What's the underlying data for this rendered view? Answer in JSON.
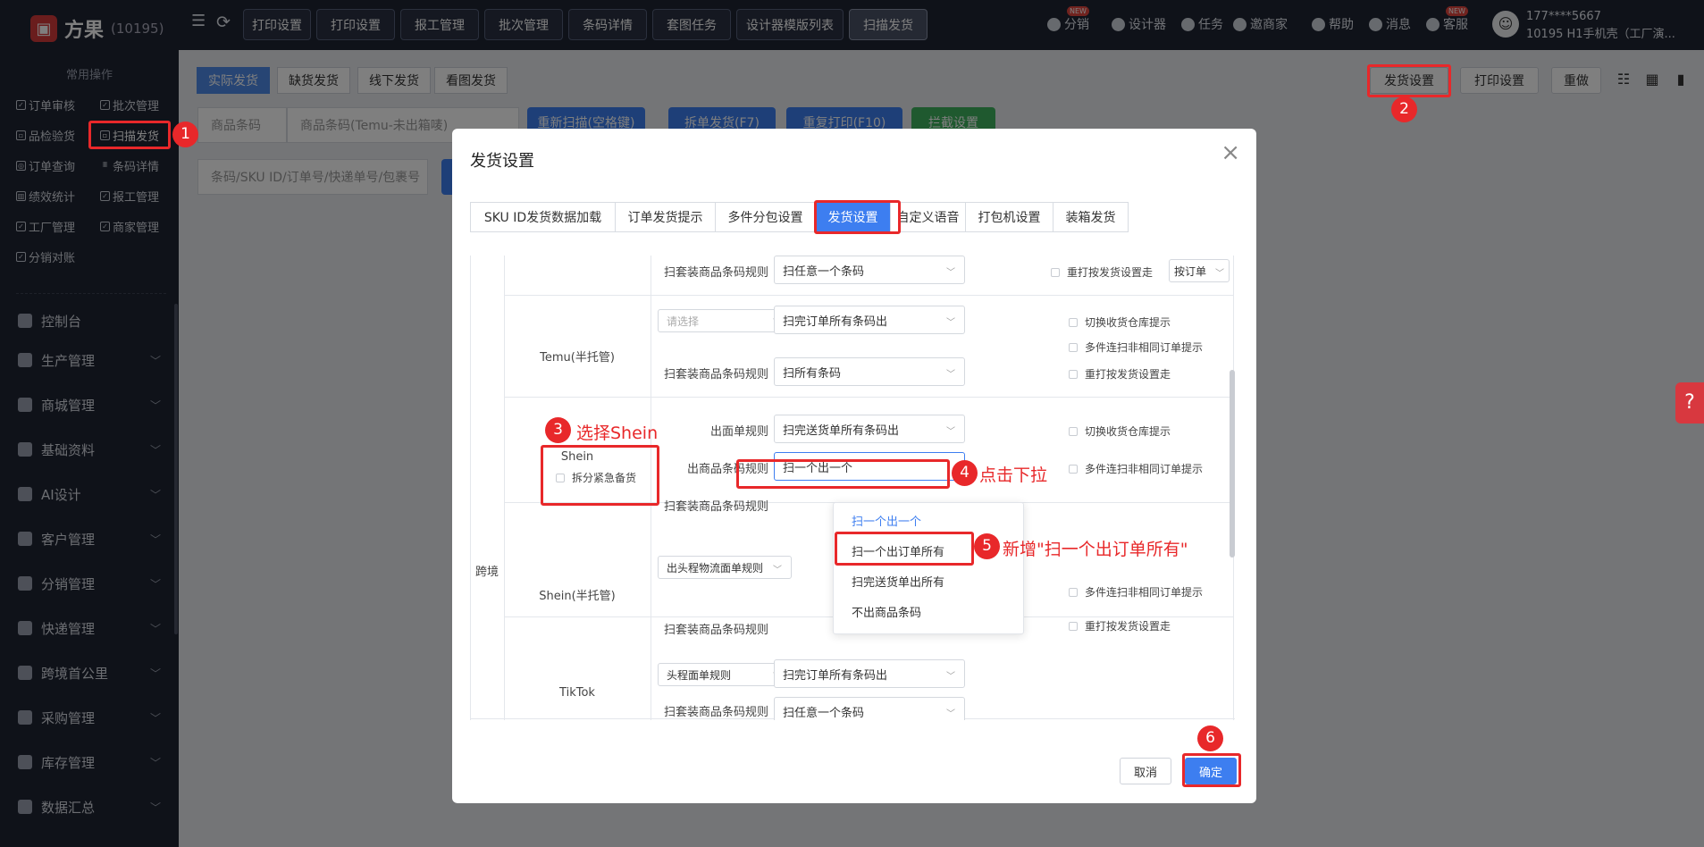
{
  "app": {
    "name": "方果",
    "count": "(10195)"
  },
  "sidebar": {
    "common_title": "常用操作",
    "quick": [
      "订单审核",
      "批次管理",
      "品检验货",
      "扫描发货",
      "订单查询",
      "条码详情",
      "绩效统计",
      "报工管理",
      "工厂管理",
      "商家管理",
      "分销对账"
    ],
    "nav": [
      "控制台",
      "生产管理",
      "商城管理",
      "基础资料",
      "AI设计",
      "客户管理",
      "分销管理",
      "快递管理",
      "跨境首公里",
      "采购管理",
      "库存管理",
      "数据汇总"
    ]
  },
  "topbar": {
    "tabs": [
      "打印设置",
      "打印设置",
      "报工管理",
      "批次管理",
      "条码详情",
      "套图任务",
      "设计器模版列表",
      "扫描发货"
    ],
    "right": [
      "分销",
      "设计器",
      "任务",
      "邀商家",
      "帮助",
      "消息",
      "客服"
    ],
    "new_badge": "NEW",
    "user_line1": "177****5667",
    "user_line2": "10195 H1手机壳（工厂演..."
  },
  "content": {
    "tabs": [
      "实际发货",
      "缺货发货",
      "线下发货",
      "看图发货"
    ],
    "right_buttons": [
      "发货设置",
      "打印设置",
      "重做"
    ],
    "product_select": "商品条码",
    "product_placeholder": "商品条码(Temu-未出箱唛)",
    "search_placeholder": "条码/SKU ID/订单号/快递单号/包裹号",
    "buttons": [
      "重新扫描(空格键)",
      "拆单发货(F7)",
      "重复打印(F10)",
      "拦截设置"
    ]
  },
  "modal": {
    "title": "发货设置",
    "tabs": [
      "SKU ID发货数据加载",
      "订单发货提示",
      "多件分包设置",
      "发货设置",
      "自定义语音",
      "打包机设置",
      "装箱发货"
    ],
    "group_label": "跨境",
    "rows": {
      "top": {
        "rule_label": "扫套装商品条码规则",
        "rule_value": "扫任意一个条码",
        "checkbox": "重打按发货设置走",
        "small_select": "按订单"
      },
      "temu": {
        "name": "Temu(半托管)",
        "select_placeholder": "请选择",
        "select_value": "扫完订单所有条码出",
        "rule_label": "扫套装商品条码规则",
        "rule_value": "扫所有条码",
        "checks": [
          "切换收货仓库提示",
          "多件连扫非相同订单提示",
          "重打按发货设置走"
        ]
      },
      "shein": {
        "name": "Shein",
        "sub_check": "拆分紧急备货",
        "label1": "出面单规则",
        "value1": "扫完送货单所有条码出",
        "label2": "出商品条码规则",
        "value2": "扫一个出一个",
        "label3": "扫套装商品条码规则",
        "checks": [
          "切换收货仓库提示",
          "多件连扫非相同订单提示"
        ]
      },
      "shein_half": {
        "name": "Shein(半托管)",
        "select_value": "出头程物流面单规则",
        "rule_label": "扫套装商品条码规则",
        "checks": [
          "多件连扫非相同订单提示",
          "重打按发货设置走"
        ]
      },
      "tiktok": {
        "name": "TikTok",
        "select_value": "头程面单规则",
        "value": "扫完订单所有条码出",
        "rule_label": "扫套装商品条码规则",
        "rule_value": "扫任意一个条码"
      }
    },
    "dropdown": [
      "扫一个出一个",
      "扫一个出订单所有",
      "扫完送货单出所有",
      "不出商品条码"
    ],
    "cancel": "取消",
    "confirm": "确定"
  },
  "annotations": {
    "numbers": [
      "1",
      "2",
      "3",
      "4",
      "5",
      "6"
    ],
    "note3": "选择Shein",
    "note4": "点击下拉",
    "note5": "新增\"扫一个出订单所有\""
  },
  "help_tab": "?",
  "colors": {
    "annotation": "#e8282a",
    "primary": "#3d7ef0",
    "sidebar": "#1f2433"
  }
}
